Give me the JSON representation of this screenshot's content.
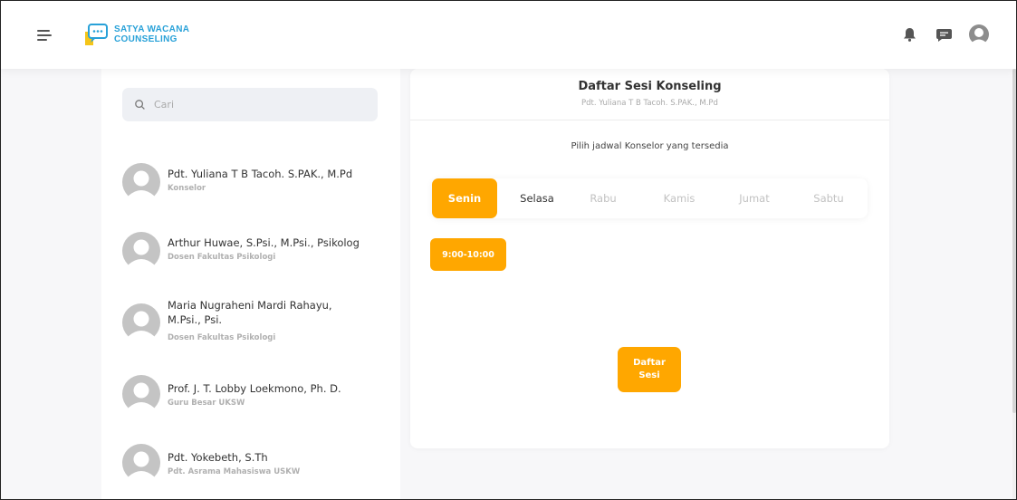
{
  "header": {
    "logo_line1": "SATYA WACANA",
    "logo_line2": "COUNSELING",
    "icons": [
      "hamburger-icon",
      "bell-icon",
      "chat-icon",
      "user-avatar-icon"
    ]
  },
  "search": {
    "placeholder": "Cari"
  },
  "counselors": [
    {
      "name": "Pdt. Yuliana T B Tacoh. S.PAK., M.Pd",
      "role": "Konselor"
    },
    {
      "name": "Arthur Huwae, S.Psi., M.Psi., Psikolog",
      "role": "Dosen Fakultas Psikologi"
    },
    {
      "name": "Maria Nugraheni Mardi Rahayu, M.Psi., Psi.",
      "role": "Dosen Fakultas Psikologi"
    },
    {
      "name": "Prof. J. T. Lobby Loekmono, Ph. D.",
      "role": "Guru Besar UKSW"
    },
    {
      "name": "Pdt. Yokebeth, S.Th",
      "role": "Pdt. Asrama Mahasiswa USKW"
    }
  ],
  "session": {
    "title": "Daftar Sesi Konseling",
    "subtitle": "Pdt. Yuliana T B Tacoh. S.PAK., M.Pd",
    "instruction": "Pilih jadwal Konselor yang tersedia",
    "days": [
      "Senin",
      "Selasa",
      "Rabu",
      "Kamis",
      "Jumat",
      "Sabtu"
    ],
    "selected_day": "Senin",
    "time_slot": "9:00-10:00",
    "register_button": "Daftar Sesi"
  },
  "colors": {
    "accent": "#ffa700",
    "brand_blue": "#28a1d8",
    "brand_yellow": "#f5c518"
  }
}
